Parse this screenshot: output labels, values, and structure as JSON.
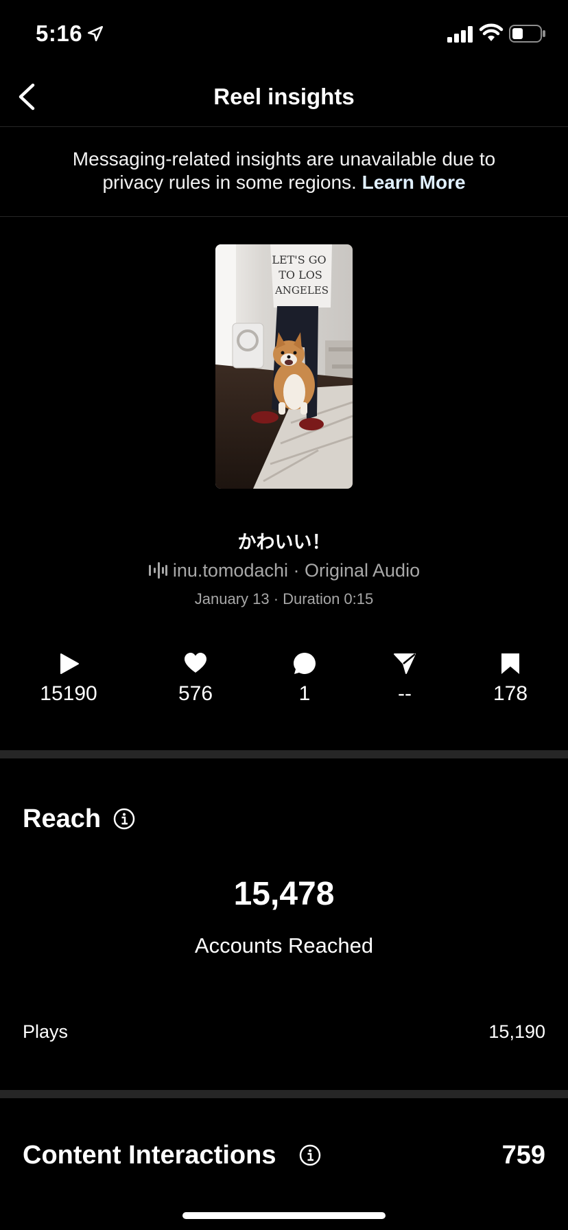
{
  "status": {
    "time": "5:16"
  },
  "nav": {
    "title": "Reel insights"
  },
  "notice": {
    "text": "Messaging-related insights are unavailable due to privacy rules in some regions.",
    "link": "Learn More"
  },
  "reel": {
    "caption": "かわいい！",
    "audio": "inu.tomodachi · Original Audio",
    "date_duration": "January 13 · Duration 0:15",
    "thumbnail_text": [
      "LET'S GO",
      "TO LOS",
      "ANGELES"
    ]
  },
  "metrics": [
    {
      "icon": "play-icon",
      "value": "15190"
    },
    {
      "icon": "heart-icon",
      "value": "576"
    },
    {
      "icon": "comment-icon",
      "value": "1"
    },
    {
      "icon": "share-icon",
      "value": "--"
    },
    {
      "icon": "bookmark-icon",
      "value": "178"
    }
  ],
  "reach": {
    "title": "Reach",
    "accounts_reached": "15,478",
    "accounts_label": "Accounts Reached",
    "plays_label": "Plays",
    "plays_value": "15,190"
  },
  "interactions": {
    "title": "Content Interactions",
    "value": "759"
  },
  "colors": {
    "background": "#000000",
    "separator": "#262626",
    "secondary_text": "#a8a8a8"
  }
}
